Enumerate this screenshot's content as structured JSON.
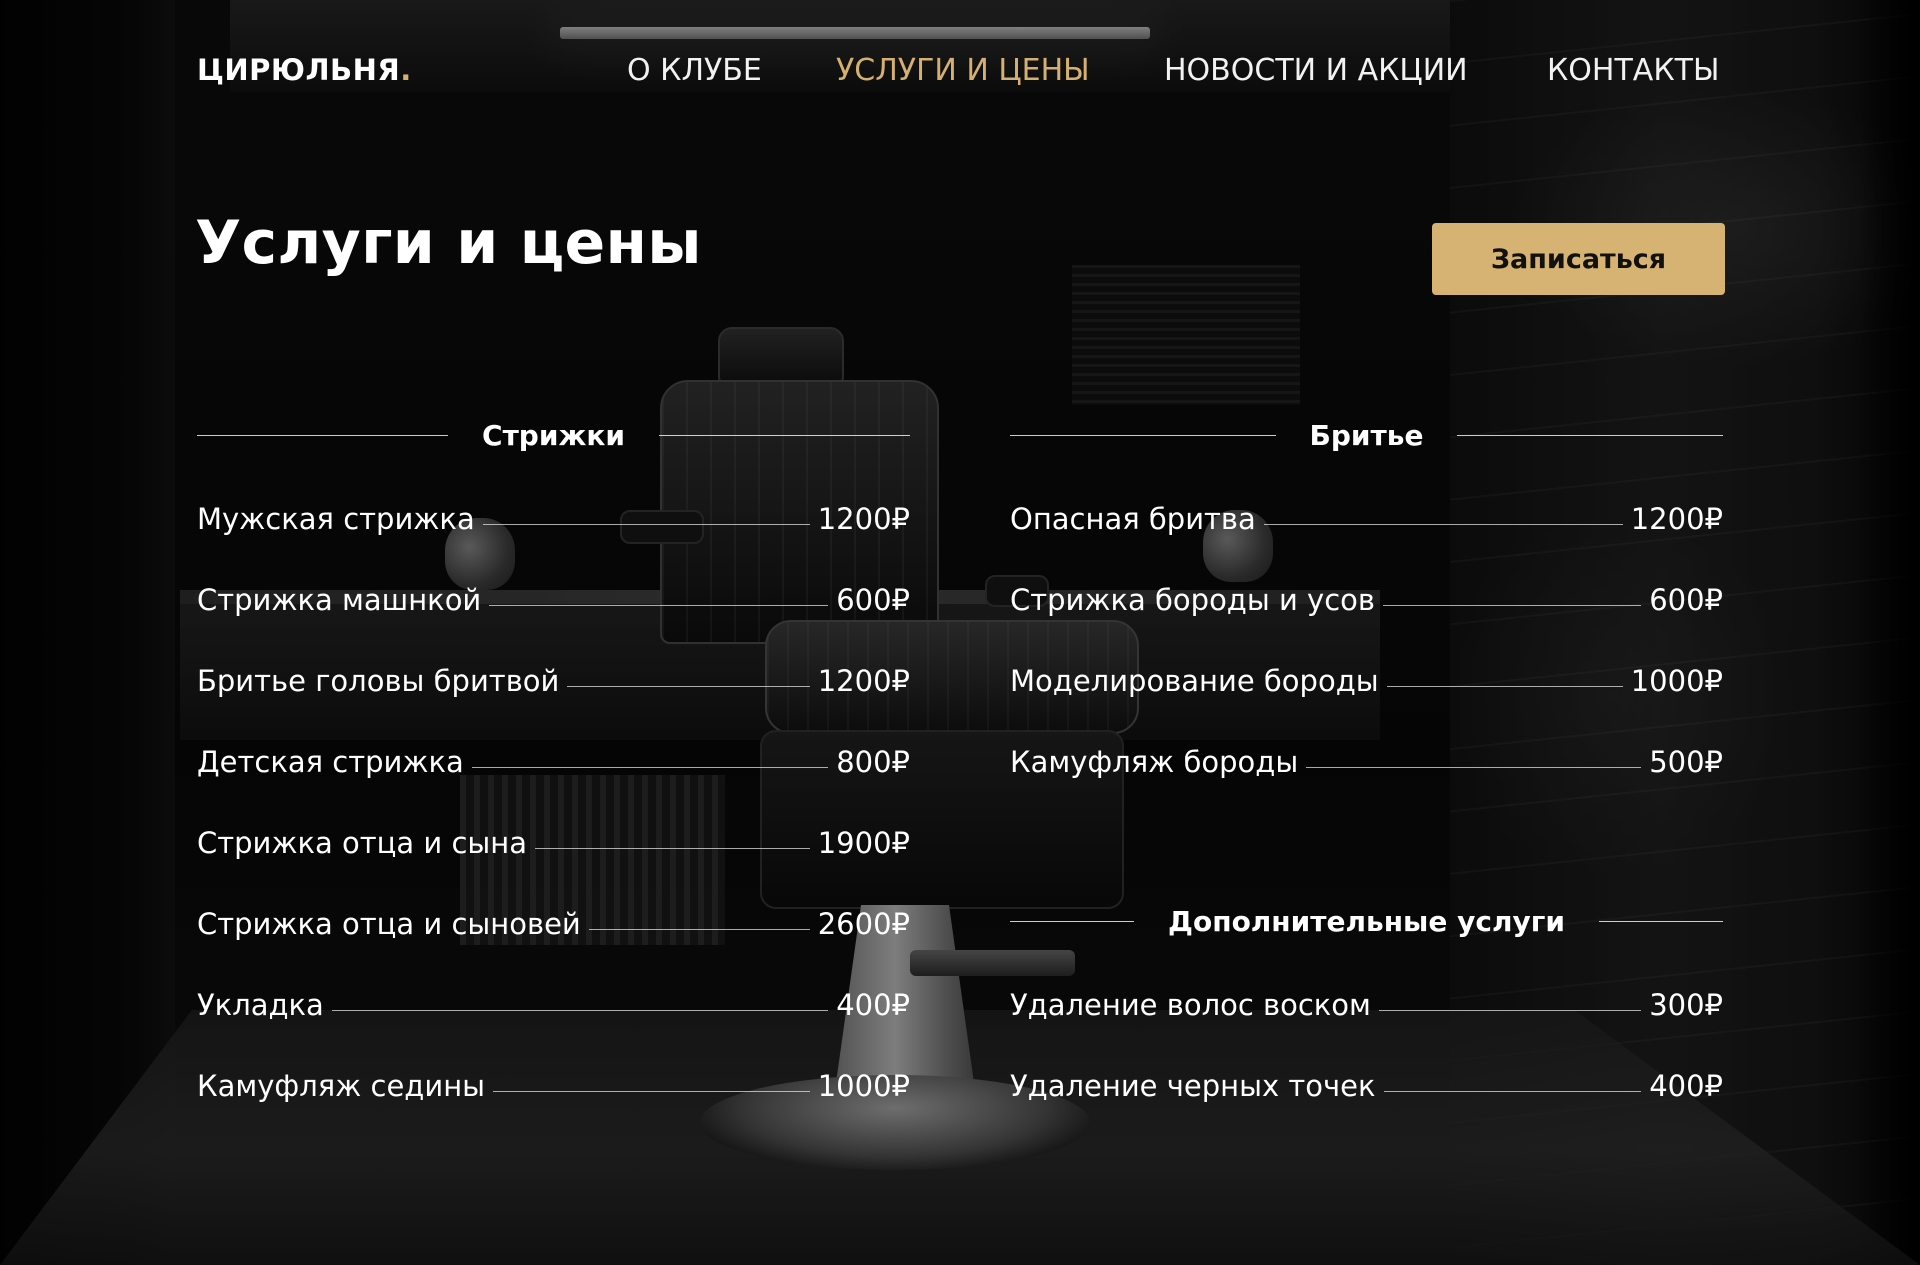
{
  "brand": {
    "name": "ЦИРЮЛЬНЯ",
    "dot": ".",
    "accent": "#d6b070"
  },
  "nav": [
    {
      "label": "О КЛУБЕ",
      "active": false
    },
    {
      "label": "УСЛУГИ И ЦЕНЫ",
      "active": true
    },
    {
      "label": "НОВОСТИ И АКЦИИ",
      "active": false
    },
    {
      "label": "КОНТАКТЫ",
      "active": false
    }
  ],
  "page": {
    "title": "Услуги и цены",
    "book_button": "Записаться"
  },
  "sections": {
    "haircuts": {
      "title": "Стрижки",
      "items": [
        {
          "name": "Мужская стрижка",
          "price": "1200₽"
        },
        {
          "name": "Стрижка машнкой",
          "price": "600₽"
        },
        {
          "name": "Бритье головы бритвой",
          "price": "1200₽"
        },
        {
          "name": "Детская стрижка",
          "price": "800₽"
        },
        {
          "name": "Стрижка отца и сына",
          "price": "1900₽"
        },
        {
          "name": "Стрижка отца и сыновей",
          "price": "2600₽"
        },
        {
          "name": "Укладка",
          "price": "400₽"
        },
        {
          "name": "Камуфляж седины",
          "price": "1000₽"
        }
      ]
    },
    "shaving": {
      "title": "Бритье",
      "items": [
        {
          "name": "Опасная бритва",
          "price": "1200₽"
        },
        {
          "name": "Стрижка бороды и усов",
          "price": "600₽"
        },
        {
          "name": "Моделирование бороды",
          "price": "1000₽"
        },
        {
          "name": "Камуфляж бороды",
          "price": "500₽"
        }
      ]
    },
    "extra": {
      "title": "Дополнительные услуги",
      "items": [
        {
          "name": "Удаление волос воском",
          "price": "300₽"
        },
        {
          "name": "Удаление черных точек",
          "price": "400₽"
        }
      ]
    }
  }
}
